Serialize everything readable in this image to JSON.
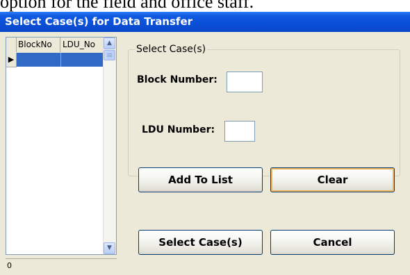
{
  "document_text": "option for the field and office staff.",
  "window": {
    "title": "Select Case(s) for Data Transfer"
  },
  "grid": {
    "columns": [
      "BlockNo",
      "LDU_No"
    ],
    "current_row_marker": "▶",
    "rows": [
      [
        "",
        ""
      ]
    ],
    "record_count": "0",
    "scroll": {
      "up_icon": "chevron-up-icon",
      "down_icon": "chevron-down-icon"
    }
  },
  "select_group": {
    "legend": "Select Case(s)",
    "block_label": "Block Number:",
    "block_value": "",
    "ldu_label": "LDU Number:",
    "ldu_value": "",
    "add_button": "Add To List",
    "clear_button": "Clear"
  },
  "footer": {
    "select_button": "Select Case(s)",
    "cancel_button": "Cancel"
  },
  "colors": {
    "title_bar": "#0a4fd8",
    "selection": "#316ac5",
    "dialog_bg": "#ece9d8",
    "button_border": "#003c74",
    "focus_outline": "#f3b55a"
  }
}
